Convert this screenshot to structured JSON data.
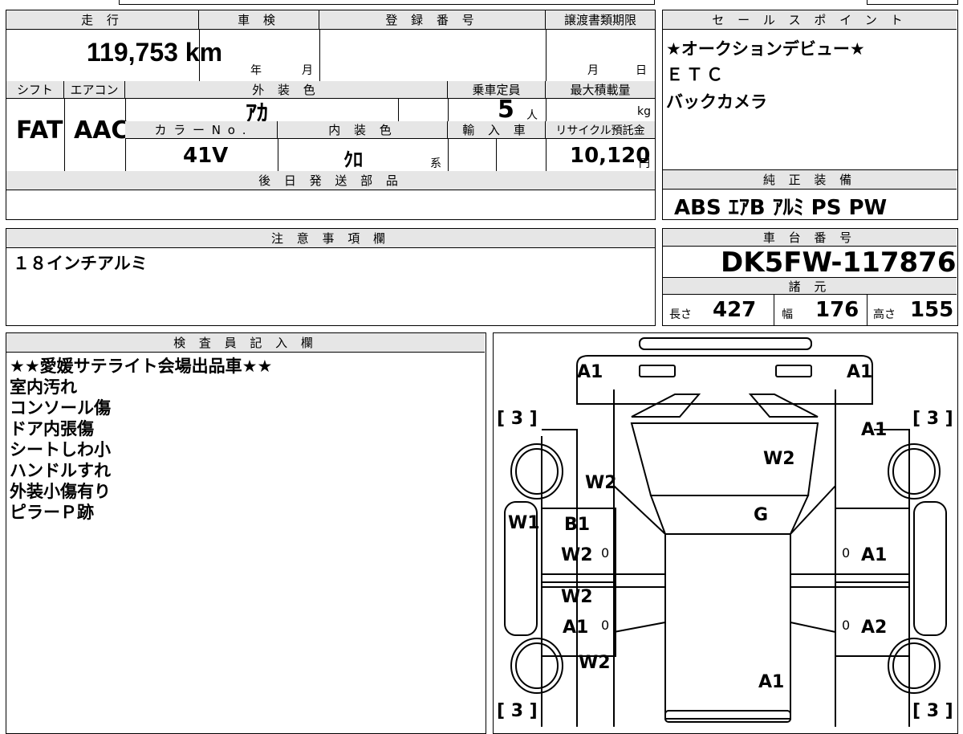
{
  "spec": {
    "mileage_label": "走 行",
    "mileage": "119,753",
    "mileage_unit": "km",
    "inspection_label": "車 検",
    "year_unit": "年",
    "month_unit": "月",
    "reg_label": "登 録 番 号",
    "transfer_label": "譲渡書類期限",
    "day_unit": "日",
    "shift_label": "シフト",
    "shift": "FAT",
    "ac_label": "エアコン",
    "ac": "AAC",
    "color_label": "外 装 色",
    "color": "ｱｶ",
    "capacity_label": "乗車定員",
    "capacity": "5",
    "capacity_unit": "人",
    "load_label": "最大積載量",
    "load_unit": "kg",
    "colorno_label": "カ ラ ー N o .",
    "colorno": "41V",
    "interior_label": "内 装 色",
    "interior": "ｸﾛ",
    "interior_unit": "系",
    "import_label": "輸 入 車",
    "recycle_label": "リサイクル預託金",
    "recycle": "10,120",
    "recycle_unit": "円",
    "later_label": "後 日 発 送 部 品"
  },
  "sales": {
    "label": "セ ー ル ス ポ イ ン ト",
    "lines": [
      "★オークションデビュー★",
      "ＥＴＣ",
      "バックカメラ"
    ]
  },
  "equipment": {
    "label": "純 正 装 備",
    "value": "ABS ｴｱB ｱﾙﾐ PS PW"
  },
  "notes": {
    "label": "注 意 事 項 欄",
    "value": "１８インチアルミ"
  },
  "chassis": {
    "label": "車 台 番 号",
    "value": "DK5FW-117876",
    "dims_label": "諸 元",
    "length_label": "長さ",
    "length": "427",
    "width_label": "幅",
    "width": "176",
    "height_label": "高さ",
    "height": "155"
  },
  "inspector": {
    "label": "検 査 員 記 入 欄",
    "lines": [
      "★★愛媛サテライト会場出品車★★",
      "室内汚れ",
      "コンソール傷",
      "ドア内張傷",
      "シートしわ小",
      "ハンドルすれ",
      "外装小傷有り",
      "ピラーＰ跡"
    ]
  },
  "diagram": {
    "marks": {
      "front_left": "A1",
      "front_right": "A1",
      "bumper_fl": "[ 3 ]",
      "bumper_fr": "[ 3 ]",
      "fender_r": "A1",
      "hood": "W2",
      "fender_l": "W2",
      "windshield": "G",
      "pillar_l": "W1",
      "door_fl_1": "B1",
      "door_fl_2": "W2",
      "door_fr": "A1",
      "door_rl_1": "W2",
      "door_rl_2": "A1",
      "door_rr": "A2",
      "quarter_l": "W2",
      "roof_rear": "A1",
      "bumper_rl": "[ 3 ]",
      "bumper_rr": "[ 3 ]",
      "zero": "0"
    }
  }
}
